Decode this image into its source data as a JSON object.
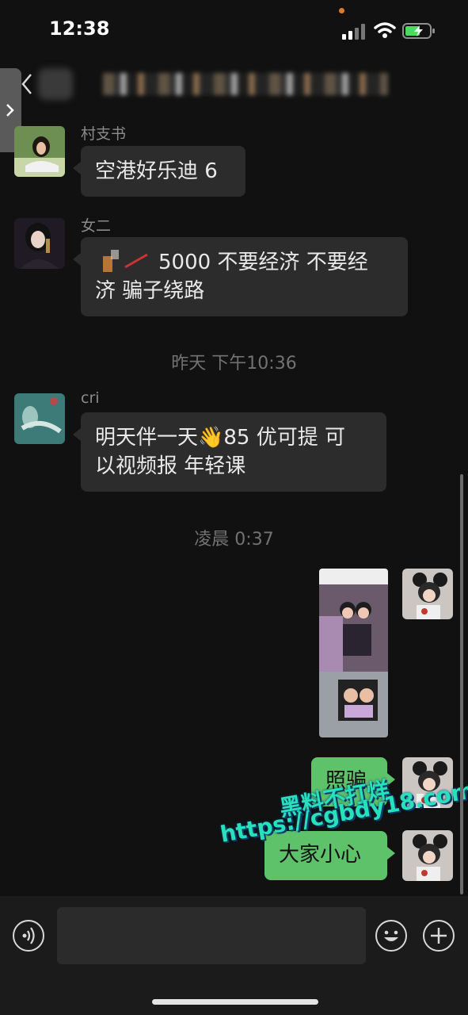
{
  "status_bar": {
    "time": "12:38"
  },
  "messages": [
    {
      "sender": "村支书",
      "text": "空港好乐迪 6"
    },
    {
      "sender": "女二",
      "text_line1": "5000 不要经济  不要经",
      "text_line2": "济 骗子绕路"
    },
    {
      "timestamp": "昨天 下午10:36"
    },
    {
      "sender": "cri",
      "text_line1": "明天伴一天👋85 优可提 可",
      "text_line2": "以视频报 年轻课"
    },
    {
      "timestamp": "凌晨 0:37"
    },
    {
      "own": true,
      "text": "照骗"
    },
    {
      "own": true,
      "text": "大家小心"
    }
  ],
  "watermark": {
    "line1": "黑料不打烊",
    "line2": "https://cgbdy18.com"
  },
  "colors": {
    "own_bubble": "#5ec26a",
    "incoming_bubble": "#2c2c2c",
    "background": "#111111"
  },
  "icons": [
    "back-icon",
    "voice-icon",
    "emoji-icon",
    "plus-icon",
    "wifi-icon",
    "battery-icon",
    "signal-icon"
  ]
}
